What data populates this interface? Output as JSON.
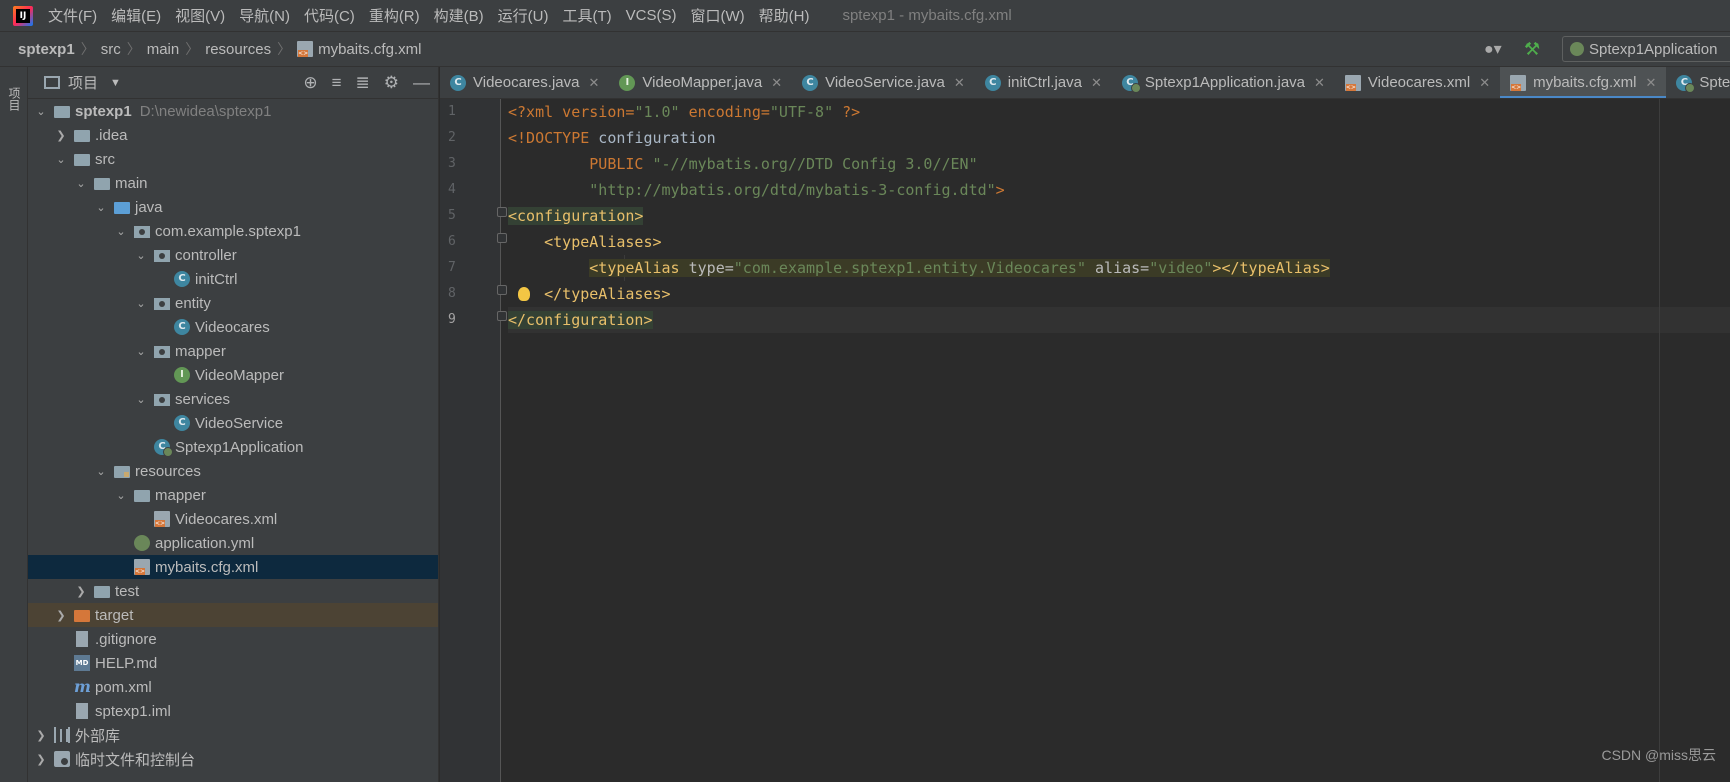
{
  "menu": {
    "items": [
      "文件(F)",
      "编辑(E)",
      "视图(V)",
      "导航(N)",
      "代码(C)",
      "重构(R)",
      "构建(B)",
      "运行(U)",
      "工具(T)",
      "VCS(S)",
      "窗口(W)",
      "帮助(H)"
    ],
    "window_title": "sptexp1 - mybaits.cfg.xml"
  },
  "navbar": {
    "breadcrumbs": [
      "sptexp1",
      "src",
      "main",
      "resources",
      "mybaits.cfg.xml"
    ],
    "run_config": "Sptexp1Application"
  },
  "left_strip": {
    "tab_label": "项目"
  },
  "project_panel": {
    "title": "项目",
    "tree": [
      {
        "label": "sptexp1",
        "hint": "D:\\newidea\\sptexp1",
        "icon": "module-folder-icon"
      },
      {
        "label": ".idea",
        "icon": "folder-icon"
      },
      {
        "label": "src",
        "icon": "folder-icon"
      },
      {
        "label": "main",
        "icon": "folder-icon"
      },
      {
        "label": "java",
        "icon": "source-folder-icon"
      },
      {
        "label": "com.example.sptexp1",
        "icon": "package-icon"
      },
      {
        "label": "controller",
        "icon": "package-icon"
      },
      {
        "label": "initCtrl",
        "icon": "class-icon"
      },
      {
        "label": "entity",
        "icon": "package-icon"
      },
      {
        "label": "Videocares",
        "icon": "class-icon"
      },
      {
        "label": "mapper",
        "icon": "package-icon"
      },
      {
        "label": "VideoMapper",
        "icon": "interface-icon"
      },
      {
        "label": "services",
        "icon": "package-icon"
      },
      {
        "label": "VideoService",
        "icon": "class-icon"
      },
      {
        "label": "Sptexp1Application",
        "icon": "spring-class-icon"
      },
      {
        "label": "resources",
        "icon": "resources-folder-icon"
      },
      {
        "label": "mapper",
        "icon": "folder-icon"
      },
      {
        "label": "Videocares.xml",
        "icon": "xml-file-icon"
      },
      {
        "label": "application.yml",
        "icon": "yml-file-icon"
      },
      {
        "label": "mybaits.cfg.xml",
        "icon": "xml-file-icon"
      },
      {
        "label": "test",
        "icon": "folder-icon"
      },
      {
        "label": "target",
        "icon": "excluded-folder-icon"
      },
      {
        "label": ".gitignore",
        "icon": "file-icon"
      },
      {
        "label": "HELP.md",
        "icon": "markdown-file-icon"
      },
      {
        "label": "pom.xml",
        "icon": "maven-icon"
      },
      {
        "label": "sptexp1.iml",
        "icon": "file-icon"
      },
      {
        "label": "外部库",
        "icon": "library-icon"
      },
      {
        "label": "临时文件和控制台",
        "icon": "scratch-icon"
      }
    ]
  },
  "tabs": [
    {
      "label": "Videocares.java",
      "icon": "class-icon"
    },
    {
      "label": "VideoMapper.java",
      "icon": "interface-icon"
    },
    {
      "label": "VideoService.java",
      "icon": "class-icon"
    },
    {
      "label": "initCtrl.java",
      "icon": "class-icon"
    },
    {
      "label": "Sptexp1Application.java",
      "icon": "spring-class-icon"
    },
    {
      "label": "Videocares.xml",
      "icon": "xml-file-icon"
    },
    {
      "label": "mybaits.cfg.xml",
      "icon": "xml-file-icon",
      "active": true
    },
    {
      "label": "Spte",
      "icon": "spring-class-icon"
    }
  ],
  "editor": {
    "line_numbers": [
      "1",
      "2",
      "3",
      "4",
      "5",
      "6",
      "7",
      "8",
      "9"
    ],
    "current_line": 9,
    "code": {
      "l1": {
        "open": "<?xml version=",
        "v1": "\"1.0\"",
        "mid": " encoding=",
        "v2": "\"UTF-8\"",
        "close": " ?>"
      },
      "l2": {
        "kw": "<!DOCTYPE",
        "name": " configuration"
      },
      "l3": {
        "kw": "PUBLIC",
        "val": " \"-//mybatis.org//DTD Config 3.0//EN\""
      },
      "l4": {
        "val": "\"http://mybatis.org/dtd/mybatis-3-config.dtd\"",
        "close": ">"
      },
      "l5": {
        "tag": "<configuration>"
      },
      "l6": {
        "tag": "<typeAliases>"
      },
      "l7": {
        "open": "<typeAlias",
        "a1": " type=",
        "v1": "\"com.example.sptexp1.entity.Videocares\"",
        "a2": " alias=",
        "v2": "\"video\"",
        "close": "></typeAlias>"
      },
      "l8": {
        "tag": "</typeAliases>"
      },
      "l9": {
        "tag": "</configuration>"
      }
    }
  },
  "watermark": "CSDN @miss思云",
  "colors": {
    "background": "#2b2b2b",
    "panel": "#3c3f41",
    "selection": "#0d293e",
    "accent_tab": "#4a88c7",
    "xml_tag": "#e8bf6a",
    "xml_value": "#6a8759"
  }
}
